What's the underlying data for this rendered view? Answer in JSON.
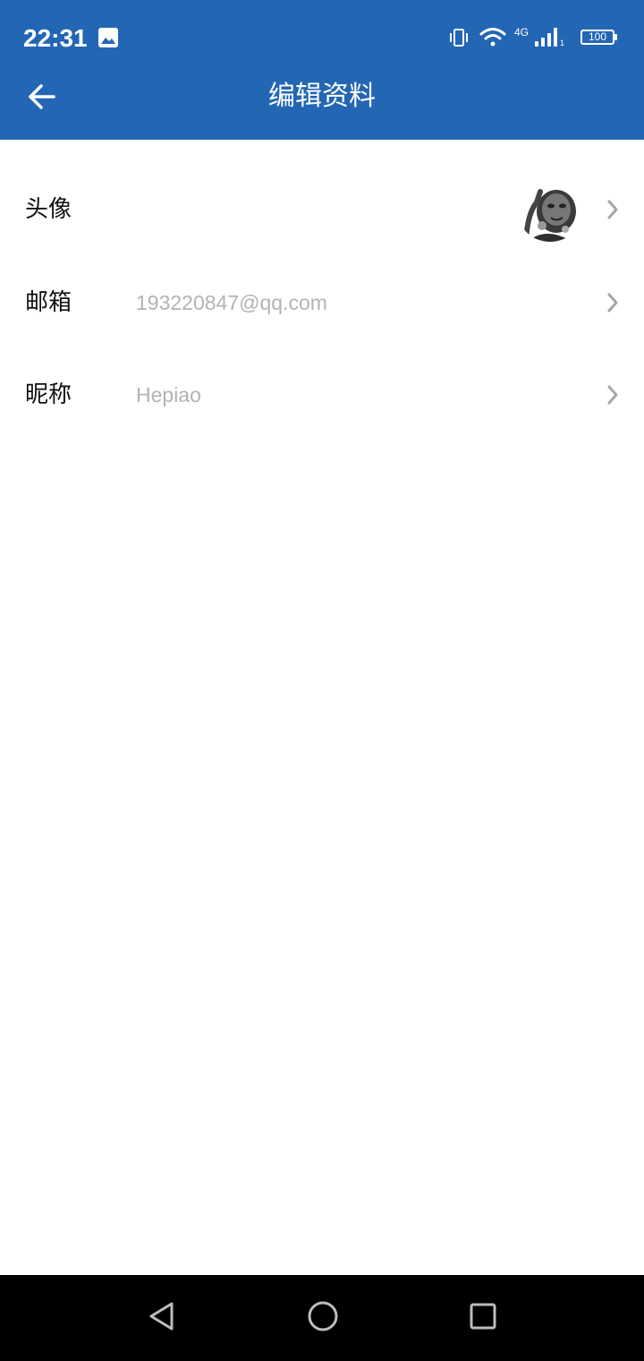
{
  "status_bar": {
    "time": "22:31",
    "network": "4G",
    "sim": "1",
    "battery": "100",
    "icons": [
      "gallery-icon",
      "vibrate-icon",
      "wifi-icon",
      "signal-icon"
    ]
  },
  "header": {
    "title": "编辑资料",
    "back_icon": "arrow-left-icon"
  },
  "rows": [
    {
      "label": "头像",
      "value": "",
      "type": "avatar"
    },
    {
      "label": "邮箱",
      "value": "193220847@qq.com"
    },
    {
      "label": "昵称",
      "value": "Hepiao"
    }
  ],
  "colors": {
    "appbar": "#2366b4",
    "value_text": "#b3b3b3",
    "chevron": "#a6a6a6"
  },
  "nav": [
    "back-icon",
    "home-icon",
    "recents-icon"
  ]
}
